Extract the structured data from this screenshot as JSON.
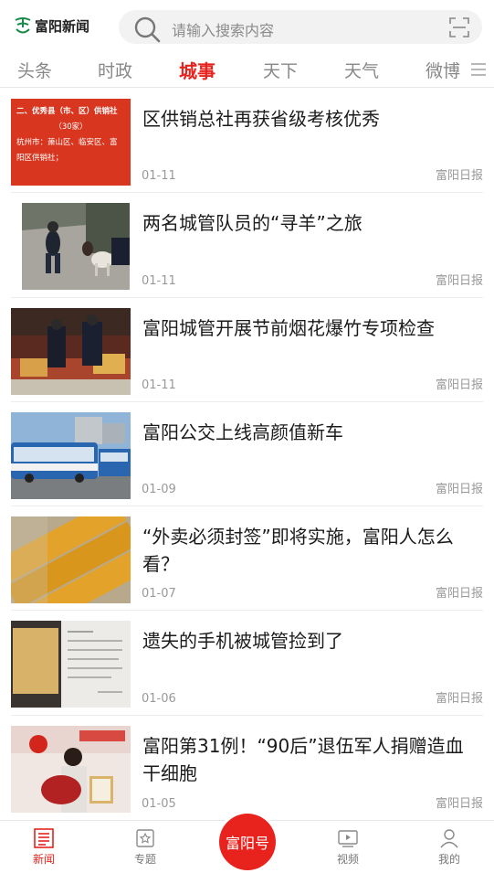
{
  "header": {
    "logo_text": "富阳新闻",
    "search_placeholder": "请输入搜索内容",
    "icons": {
      "search": "search-icon",
      "scan": "scan-icon",
      "logo": "logo-icon"
    }
  },
  "tabs": [
    {
      "label": "头条"
    },
    {
      "label": "时政"
    },
    {
      "label": "城事",
      "active": true
    },
    {
      "label": "天下"
    },
    {
      "label": "天气"
    },
    {
      "label": "微博"
    }
  ],
  "accent_color": "#e8231e",
  "news": [
    {
      "title": "区供销总社再获省级考核优秀",
      "date": "01-11",
      "source": "富阳日报",
      "thumb_text": [
        "二、优秀县（市、区）供销社",
        "（30家）",
        "杭州市：萧山区、临安区、富",
        "阳区供销社；"
      ]
    },
    {
      "title": "两名城管队员的“寻羊”之旅",
      "date": "01-11",
      "source": "富阳日报"
    },
    {
      "title": "富阳城管开展节前烟花爆竹专项检查",
      "date": "01-11",
      "source": "富阳日报"
    },
    {
      "title": "富阳公交上线高颜值新车",
      "date": "01-09",
      "source": "富阳日报"
    },
    {
      "title": "“外卖必须封签”即将实施，富阳人怎么看？",
      "date": "01-07",
      "source": "富阳日报"
    },
    {
      "title": "遗失的手机被城管捡到了",
      "date": "01-06",
      "source": "富阳日报"
    },
    {
      "title": "富阳第31例！“90后”退伍军人捐赠造血干细胞",
      "date": "01-05",
      "source": "富阳日报"
    }
  ],
  "bottom_nav": {
    "news": "新闻",
    "topics": "专题",
    "center": "富阳号",
    "video": "视频",
    "mine": "我的"
  }
}
